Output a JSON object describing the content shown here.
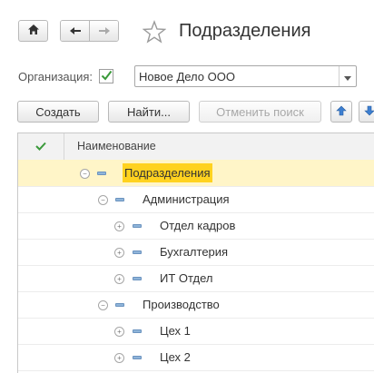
{
  "window": {
    "title": "Подразделения"
  },
  "toolbar": {
    "home_icon": "home-icon",
    "back_icon": "arrow-left-icon",
    "forward_icon": "arrow-right-icon",
    "favorite_icon": "star-outline-icon"
  },
  "filter": {
    "org_label": "Организация:",
    "org_checked": true,
    "org_value": "Новое Дело ООО"
  },
  "commands": {
    "create": "Создать",
    "find": "Найти...",
    "cancel_search": "Отменить поиск"
  },
  "table": {
    "header_name": "Наименование",
    "rows": [
      {
        "label": "Подразделения",
        "level": 0,
        "expander": "minus",
        "selected": true
      },
      {
        "label": "Администрация",
        "level": 1,
        "expander": "minus",
        "selected": false
      },
      {
        "label": "Отдел кадров",
        "level": 2,
        "expander": "plus",
        "selected": false
      },
      {
        "label": "Бухгалтерия",
        "level": 2,
        "expander": "plus",
        "selected": false
      },
      {
        "label": "ИТ Отдел",
        "level": 2,
        "expander": "plus",
        "selected": false
      },
      {
        "label": "Производство",
        "level": 1,
        "expander": "minus",
        "selected": false
      },
      {
        "label": "Цех 1",
        "level": 2,
        "expander": "plus",
        "selected": false
      },
      {
        "label": "Цех 2",
        "level": 2,
        "expander": "plus",
        "selected": false
      }
    ]
  },
  "colors": {
    "selected_row": "#fff5c8",
    "highlight": "#ffd21f",
    "check_green": "#3a9a3a",
    "arrow_blue": "#3d7fd1"
  }
}
